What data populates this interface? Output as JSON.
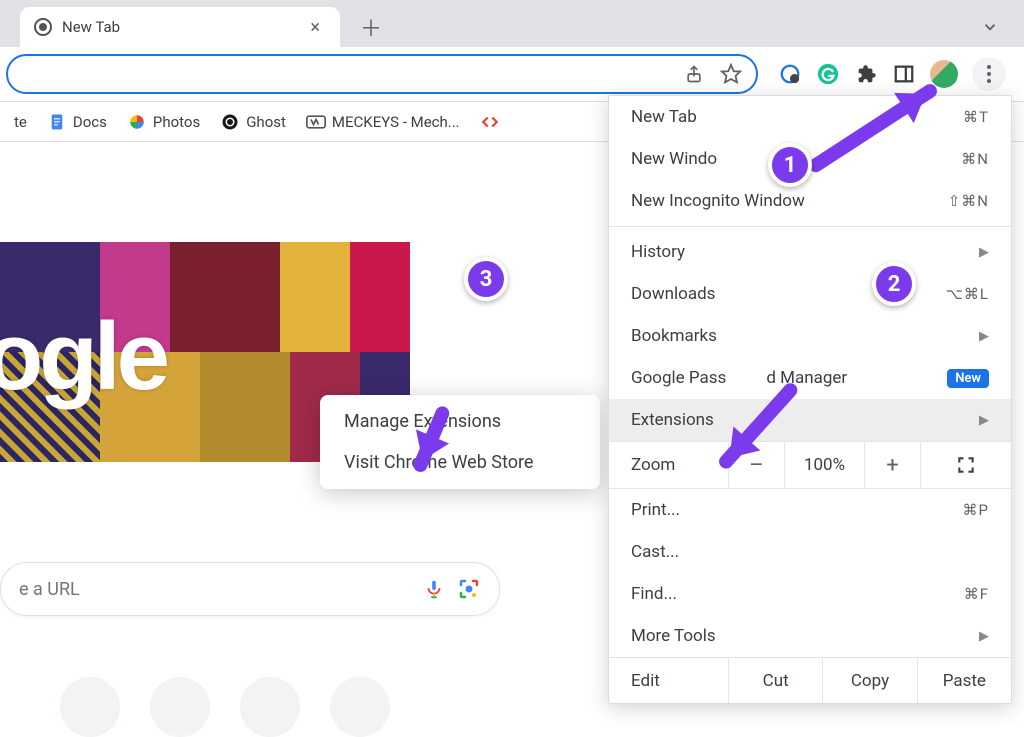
{
  "tab": {
    "title": "New Tab"
  },
  "bookmarks": [
    {
      "label": "te",
      "icon": "doc"
    },
    {
      "label": "Docs",
      "icon": "docs"
    },
    {
      "label": "Photos",
      "icon": "photos"
    },
    {
      "label": "Ghost",
      "icon": "ghost"
    },
    {
      "label": "MECKEYS - Mech...",
      "icon": "meckeys"
    },
    {
      "label": "",
      "icon": "code"
    }
  ],
  "doodle": {
    "logo_text": "oogle"
  },
  "search": {
    "placeholder": "e a URL",
    "mic_icon": "voice-search-icon",
    "lens_icon": "lens-icon"
  },
  "submenu": {
    "items": [
      "Manage Extensions",
      "Visit Chrome Web Store"
    ]
  },
  "menu": {
    "new_tab": "New Tab",
    "new_tab_sc": "⌘T",
    "new_window": "New Windo",
    "new_window_sc": "⌘N",
    "new_incognito": "New Incognito Window",
    "new_incognito_sc": "⇧⌘N",
    "history": "History",
    "downloads": "Downloads",
    "downloads_sc": "⌥⌘L",
    "bookmarks": "Bookmarks",
    "pwmgr_pre": "Google Pass",
    "pwmgr_post": "d Manager",
    "pwmgr_badge": "New",
    "extensions": "Extensions",
    "zoom_label": "Zoom",
    "zoom_value": "100%",
    "zoom_minus": "–",
    "zoom_plus": "+",
    "print": "Print...",
    "print_sc": "⌘P",
    "cast": "Cast...",
    "find": "Find...",
    "find_sc": "⌘F",
    "more_tools": "More Tools",
    "edit": "Edit",
    "cut": "Cut",
    "copy": "Copy",
    "paste": "Paste"
  },
  "annotations": {
    "b1": "1",
    "b2": "2",
    "b3": "3"
  }
}
